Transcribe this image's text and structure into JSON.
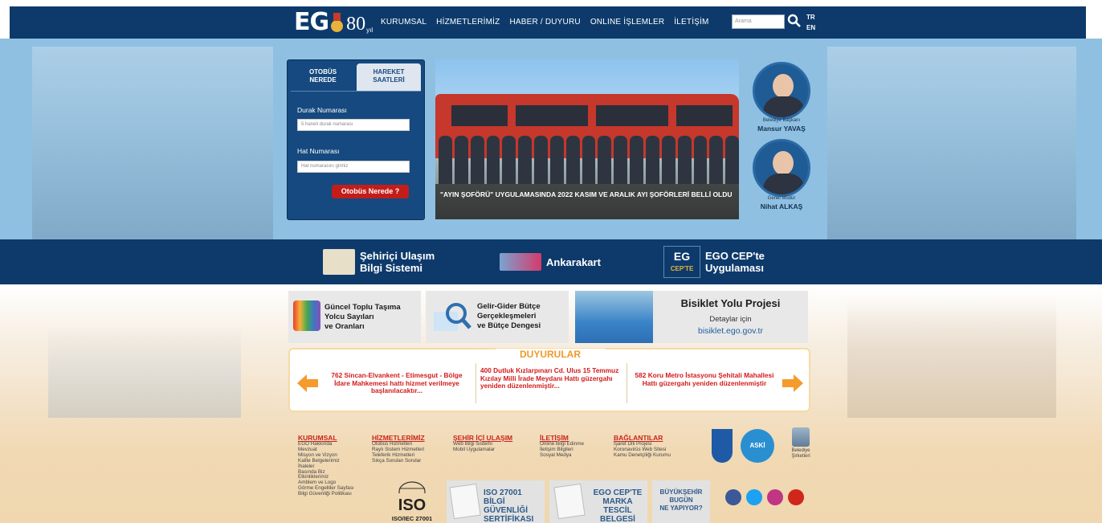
{
  "header": {
    "logo_brand": "EG",
    "logo_years": "80",
    "logo_suffix": "yıl",
    "nav": [
      "KURUMSAL",
      "HİZMETLERİMİZ",
      "HABER / DUYURU",
      "ONLINE İŞLEMLER",
      "İLETİŞİM"
    ],
    "search_placeholder": "Arama",
    "lang": [
      "TR",
      "EN"
    ]
  },
  "widget": {
    "tab_active": [
      "OTOBÜS",
      "NEREDE"
    ],
    "tab_inactive": [
      "HAREKET",
      "SAATLERİ"
    ],
    "stop_label": "Durak Numarası",
    "stop_placeholder": "5 haneli durak numarası",
    "line_label": "Hat Numarası",
    "line_placeholder": "Hat numarasını giriniz",
    "button": "Otobüs Nerede ?"
  },
  "slide": {
    "caption": "\"AYIN ŞOFÖRÜ\" UYGULAMASINDA 2022 KASIM VE ARALIK AYI ŞOFÖRLERİ BELLİ OLDU"
  },
  "officials": [
    {
      "title": "Belediye Başkanı",
      "name": "Mansur YAVAŞ"
    },
    {
      "title": "Genel Müdür",
      "name": "Nihat ALKAŞ"
    }
  ],
  "band": {
    "item1": [
      "Şehiriçi Ulaşım",
      "Bilgi Sistemi"
    ],
    "item2": "Ankarakart",
    "item3_logo": [
      "EG",
      "CEP'TE"
    ],
    "item3": [
      "EGO CEP'te",
      "Uygulaması"
    ]
  },
  "promos": {
    "p1": [
      "Güncel Toplu Taşıma",
      "Yolcu Sayıları",
      "ve Oranları"
    ],
    "p2": [
      "Gelir-Gider Bütçe",
      "Gerçekleşmeleri",
      "ve Bütçe Dengesi"
    ],
    "p3_title": "Bisiklet Yolu Projesi",
    "p3_sub": "Detaylar için",
    "p3_link": "bisiklet.ego.gov.tr"
  },
  "announcements": {
    "title": "DUYURULAR",
    "items": [
      "762 Sincan-Elvankent - Etimesgut - Bölge İdare Mahkemesi hattı hizmet verilmeye başlanılacaktır...",
      "400 Dutluk Kızlarpınarı Cd. Ulus 15 Temmuz Kızılay Milli İrade Meydanı Hattı güzergahı yeniden düzenlenmiştir...",
      "582 Koru Metro İstasyonu Şehitali Mahallesi Hattı güzergahı yeniden düzenlenmiştir"
    ]
  },
  "footer": {
    "columns": [
      {
        "title": "KURUMSAL",
        "links": [
          "EGO Hakkında",
          "Mevzuat",
          "Misyon ve Vizyon",
          "Kalite Belgelerimiz",
          "İhaleler",
          "Basında Biz",
          "Etkinliklerimiz",
          "Amblem ve Logo",
          "Görme Engelliler Sayfası",
          "Bilgi Güvenliği Politikası"
        ]
      },
      {
        "title": "HİZMETLERİMİZ",
        "links": [
          "Otobüs Hizmetleri",
          "Raylı Sistem Hizmetleri",
          "Teleferik Hizmetleri",
          "Sıkça Sorulan Sorular"
        ]
      },
      {
        "title": "ŞEHİR İÇİ ULAŞIM",
        "links": [
          "Web Bilgi Sistemi",
          "Mobil Uygulamalar"
        ]
      },
      {
        "title": "İLETİŞİM",
        "links": [
          "Online Bilgi Edinme",
          "İletişim Bilgileri",
          "Sosyal Medya"
        ]
      },
      {
        "title": "BAĞLANTILAR",
        "links": [
          "İşaret Dili Projesi",
          "Koronavirüs Web Sitesi",
          "Kamu Denetçiliği Kurumu"
        ]
      }
    ],
    "iso_logo": "ISO",
    "iso_sub": "ISO/IEC 27001",
    "badge1": [
      "ISO 27001",
      "BİLGİ GÜVENLİĞİ",
      "SERTİFİKASI"
    ],
    "badge2": [
      "EGO CEP'TE",
      "MARKA TESCİL",
      "BELGESİ"
    ],
    "badge3": [
      "BÜYÜKŞEHİR",
      "BUGÜN",
      "NE YAPIYOR?"
    ],
    "aski": "ASKİ",
    "subsidiaries": [
      "Belediye",
      "Şirketleri"
    ],
    "social_colors": [
      "#3b5998",
      "#1da1f2",
      "#c13584",
      "#d0261c"
    ]
  }
}
